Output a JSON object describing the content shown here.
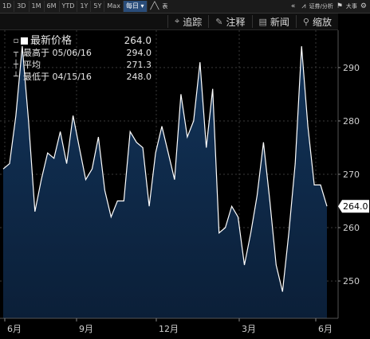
{
  "toolbar": {
    "periods": [
      "1D",
      "3D",
      "1M",
      "6M",
      "YTD",
      "1Y",
      "5Y",
      "Max"
    ],
    "active_period_label": "每日",
    "chart_type_label": "表",
    "compare_label": "证券/分析",
    "news_flag_label": "大事"
  },
  "tools": {
    "track_label": "追踪",
    "annotate_label": "注释",
    "news_label": "新闻",
    "zoom_label": "缩放"
  },
  "legend": {
    "title": "最新价格",
    "title_value": "264.0",
    "high_label": "最高于",
    "high_date": "05/06/16",
    "high_value": "294.0",
    "avg_label": "平均",
    "avg_value": "271.3",
    "low_label": "最低于",
    "low_date": "04/15/16",
    "low_value": "248.0"
  },
  "colors": {
    "line": "#ffffff",
    "fill_top": "#12345a",
    "fill_bottom": "#0b1f38",
    "last_tag_bg": "#ffffff",
    "last_tag_fg": "#000000"
  },
  "chart_data": {
    "type": "area",
    "ylim": [
      243,
      297
    ],
    "yticks": [
      250,
      260,
      270,
      280,
      290
    ],
    "xticks": [
      "6月",
      "9月",
      "12月",
      "3月",
      "6月"
    ],
    "last_value": "264.0",
    "values": [
      271,
      272,
      281,
      294,
      280,
      263,
      269,
      274,
      273,
      278,
      272,
      281,
      275,
      269,
      271,
      277,
      267,
      262,
      265,
      265,
      278,
      276,
      275,
      264,
      274,
      279,
      274,
      269,
      285,
      277,
      280,
      291,
      275,
      286,
      259,
      260,
      264,
      262,
      253,
      259,
      266,
      276,
      265,
      253,
      248,
      259,
      272,
      294,
      279,
      268,
      268,
      264
    ]
  }
}
